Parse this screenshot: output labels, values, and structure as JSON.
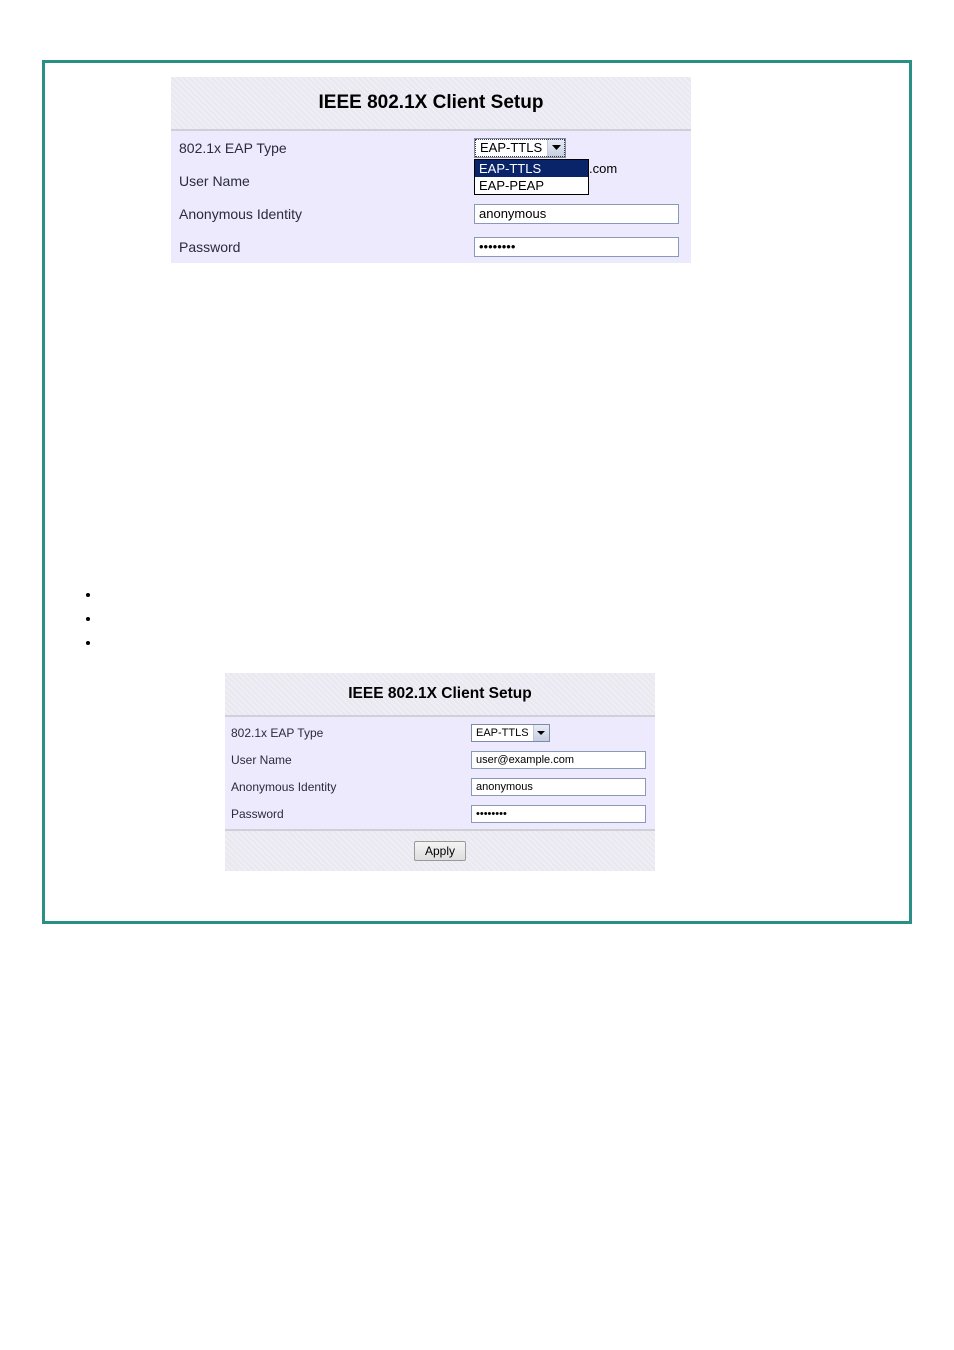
{
  "panel1": {
    "title": "IEEE 802.1X Client Setup",
    "rows": {
      "eap_type": {
        "label": "802.1x EAP Type",
        "selected": "EAP-TTLS",
        "options": [
          "EAP-TTLS",
          "EAP-PEAP"
        ]
      },
      "user_name": {
        "label": "User Name",
        "visible_fragment": ".com"
      },
      "anon_identity": {
        "label": "Anonymous Identity",
        "value": "anonymous"
      },
      "password": {
        "label": "Password",
        "masked_value": "••••••••"
      }
    }
  },
  "bullets": [
    "",
    "",
    ""
  ],
  "panel2": {
    "title": "IEEE 802.1X Client Setup",
    "rows": {
      "eap_type": {
        "label": "802.1x EAP Type",
        "selected": "EAP-TTLS"
      },
      "user_name": {
        "label": "User Name",
        "value": "user@example.com"
      },
      "anon_identity": {
        "label": "Anonymous Identity",
        "value": "anonymous"
      },
      "password": {
        "label": "Password",
        "masked_value": "••••••••"
      }
    },
    "apply_label": "Apply"
  }
}
